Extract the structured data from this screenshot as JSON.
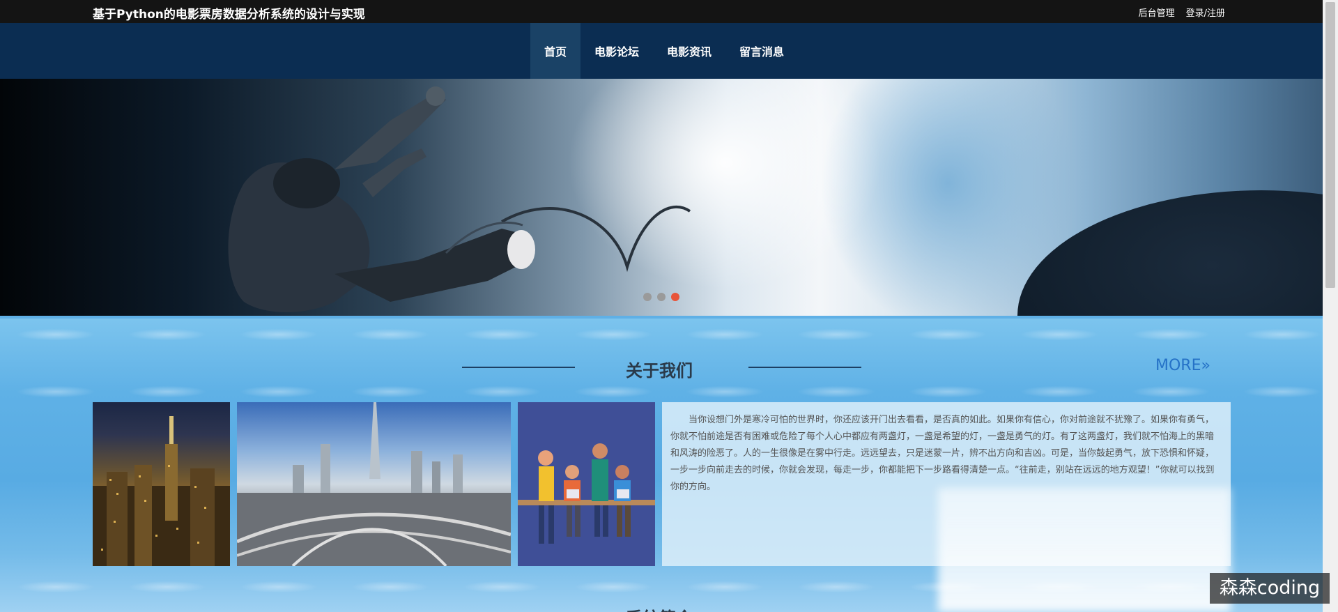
{
  "header": {
    "site_title": "基于Python的电影票房数据分析系统的设计与实现",
    "admin_link": "后台管理",
    "login_link": "登录/注册"
  },
  "nav": {
    "items": [
      {
        "label": "首页",
        "active": true
      },
      {
        "label": "电影论坛",
        "active": false
      },
      {
        "label": "电影资讯",
        "active": false
      },
      {
        "label": "留言消息",
        "active": false
      }
    ]
  },
  "carousel": {
    "slide_count": 3,
    "active_index": 2
  },
  "about": {
    "title": "关于我们",
    "more_label": "MORE",
    "paragraph": "当你设想门外是寒冷可怕的世界时，你还应该开门出去看看，是否真的如此。如果你有信心，你对前途就不犹豫了。如果你有勇气，你就不怕前途是否有困难或危险了每个人心中都应有两盏灯，一盏是希望的灯，一盏是勇气的灯。有了这两盏灯，我们就不怕海上的黑暗和风涛的险恶了。人的一生很像是在雾中行走。远远望去，只是迷蒙一片，辨不出方向和吉凶。可是，当你鼓起勇气，放下恐惧和怀疑，一步一步向前走去的时候，你就会发现，每走一步，你都能把下一步路看得清楚一点。“往前走，别站在远远的地方观望！”你就可以找到你的方向。"
  },
  "next_section": {
    "title": "系统简介"
  },
  "watermark": "森森coding",
  "colors": {
    "topbar": "#141414",
    "navbar": "#0b2d52",
    "nav_active": "#1a4266",
    "dot_active": "#e8543a",
    "more_link": "#2572c7"
  }
}
